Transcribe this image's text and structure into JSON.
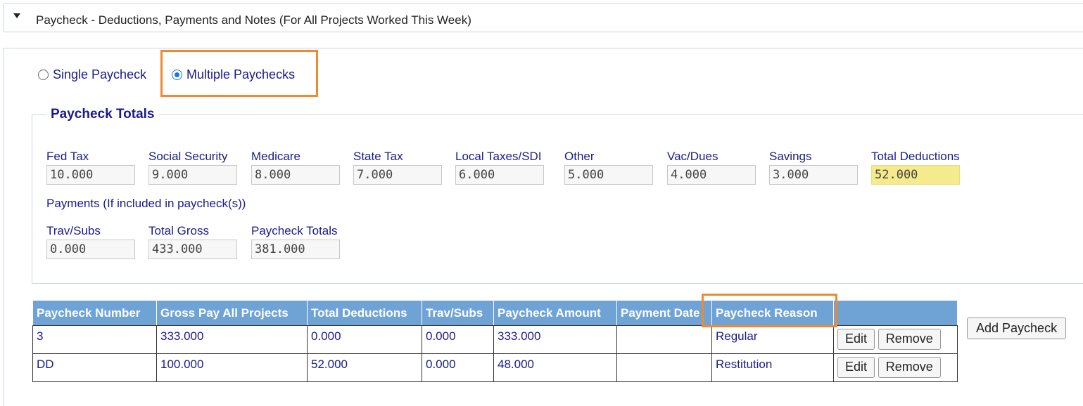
{
  "section": {
    "title": "Paycheck - Deductions, Payments and Notes (For All Projects Worked This Week)"
  },
  "paycheck_mode": {
    "options": [
      {
        "label": "Single Paycheck",
        "checked": false
      },
      {
        "label": "Multiple Paychecks",
        "checked": true
      }
    ]
  },
  "totals": {
    "legend": "Paycheck Totals",
    "deductions": [
      {
        "label": "Fed Tax",
        "value": "10.000"
      },
      {
        "label": "Social Security",
        "value": "9.000"
      },
      {
        "label": "Medicare",
        "value": "8.000"
      },
      {
        "label": "State Tax",
        "value": "7.000"
      },
      {
        "label": "Local Taxes/SDI",
        "value": "6.000"
      },
      {
        "label": "Other",
        "value": "5.000"
      },
      {
        "label": "Vac/Dues",
        "value": "4.000"
      },
      {
        "label": "Savings",
        "value": "3.000"
      },
      {
        "label": "Total Deductions",
        "value": "52.000"
      }
    ],
    "payments_label": "Payments (If included in paycheck(s))",
    "payments": [
      {
        "label": "Trav/Subs",
        "value": "0.000"
      },
      {
        "label": "Total Gross",
        "value": "433.000"
      },
      {
        "label": "Paycheck Totals",
        "value": "381.000"
      }
    ]
  },
  "table": {
    "headers": [
      "Paycheck Number",
      "Gross Pay All Projects",
      "Total Deductions",
      "Trav/Subs",
      "Paycheck Amount",
      "Payment Date",
      "Paycheck Reason",
      ""
    ],
    "rows": [
      {
        "number": "3",
        "gross": "333.000",
        "deductions": "0.000",
        "trav": "0.000",
        "amount": "333.000",
        "date": "",
        "reason": "Regular"
      },
      {
        "number": "DD",
        "gross": "100.000",
        "deductions": "52.000",
        "trav": "0.000",
        "amount": "48.000",
        "date": "",
        "reason": "Restitution"
      }
    ],
    "edit_label": "Edit",
    "remove_label": "Remove"
  },
  "add_paycheck_label": "Add Paycheck",
  "colors": {
    "header_bg": "#6fa3d6",
    "highlight": "#ef8a2e",
    "total_field": "#f5ea8c",
    "text": "#1a1a8c"
  }
}
